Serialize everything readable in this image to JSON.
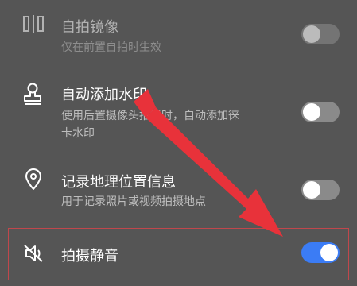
{
  "settings": {
    "mirror": {
      "title": "自拍镜像",
      "subtitle": "仅在前置自拍时生效",
      "enabled": false
    },
    "watermark": {
      "title": "自动添加水印",
      "subtitle_line1": "使用后置摄像头拍摄时，自动添加徕",
      "subtitle_line2": "卡水印",
      "enabled": false
    },
    "location": {
      "title": "记录地理位置信息",
      "subtitle": "用于记录照片或视频拍摄地点",
      "enabled": false
    },
    "mute": {
      "title": "拍摄静音",
      "enabled": true
    }
  },
  "icons": {
    "mirror": "mirror-icon",
    "watermark": "stamp-icon",
    "location": "location-pin-icon",
    "mute": "speaker-mute-icon"
  },
  "colors": {
    "background": "#555555",
    "toggle_on": "#3b7cf5",
    "toggle_off": "#8a8a8a",
    "annotation": "#e8323a"
  }
}
